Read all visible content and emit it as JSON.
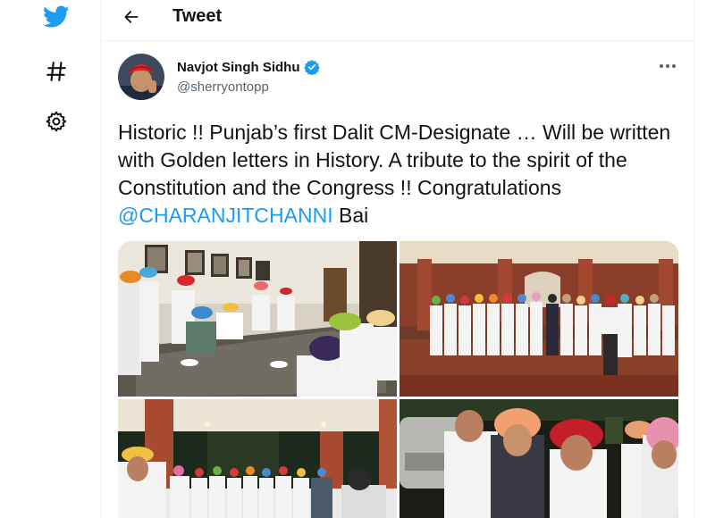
{
  "nav": {
    "icons": [
      "twitter-bird-icon",
      "hashtag-icon",
      "gear-icon"
    ],
    "brand_color": "#1d9bf0"
  },
  "header": {
    "title": "Tweet",
    "back_icon": "arrow-left-icon"
  },
  "tweet": {
    "author": {
      "name": "Navjot Singh Sidhu",
      "handle": "@sherryontopp",
      "verified": true
    },
    "text_before_mention": "Historic !! Punjab’s first Dalit CM-Designate … Will be written with Golden letters in History. A tribute to the spirit of the Constitution and the Congress !! Congratulations ",
    "mention": "@CHARANJITCHANNI",
    "text_after_mention": " Bai",
    "mention_color": "#1d9bf0",
    "photos": [
      {
        "scene": "leaders seated around a glass table in a room with framed pictures"
      },
      {
        "scene": "group of leaders standing in a line in a brick courtyard"
      },
      {
        "scene": "group photo under a porch at night"
      },
      {
        "scene": "leaders greeting each other outdoors at night"
      }
    ]
  }
}
